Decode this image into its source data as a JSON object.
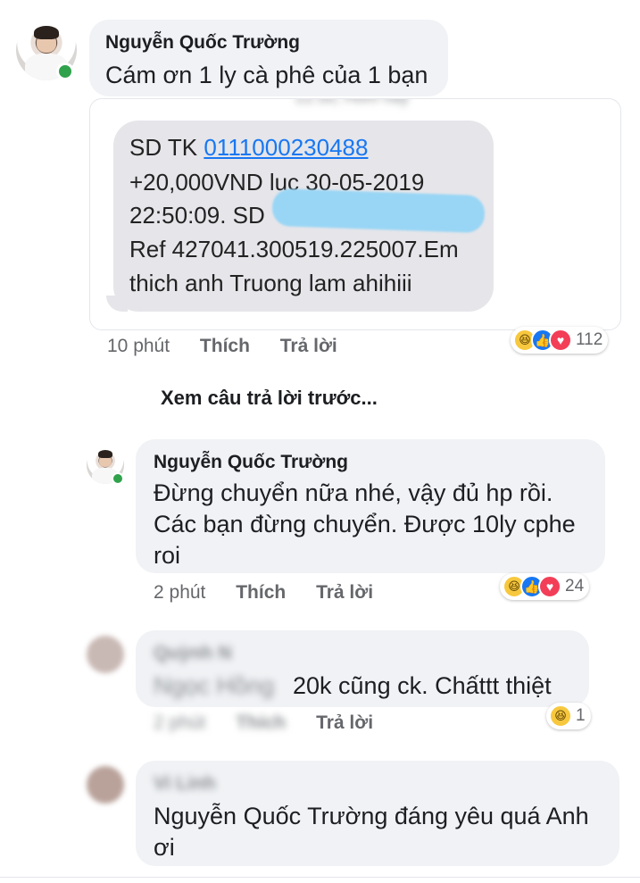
{
  "comments": [
    {
      "author": "Nguyễn Quốc Trường",
      "text": "Cám ơn 1 ly cà phê của 1 bạn",
      "attachment": {
        "header_partial": "22:50, Hôm nay",
        "lines": [
          {
            "prefix": "SD TK ",
            "link": "0111000230488"
          },
          {
            "text": "+20,000VND luc 30-05-2019"
          },
          {
            "text": "22:50:09. SD"
          },
          {
            "text": "Ref 427041.300519.225007.Em"
          },
          {
            "text": "thich anh Truong lam ahihiii"
          }
        ]
      },
      "time": "10 phút",
      "like_label": "Thích",
      "reply_label": "Trả lời",
      "reactions": [
        "haha",
        "like",
        "love"
      ],
      "reaction_count": "112"
    }
  ],
  "view_previous_replies": "Xem câu trả lời trước...",
  "replies": [
    {
      "author": "Nguyễn Quốc Trường",
      "lines": [
        "Đừng chuyển nữa nhé, vậy đủ hp rồi.",
        "Các bạn đừng chuyển. Được 10ly cphe",
        "roi"
      ],
      "time": "2 phút",
      "like_label": "Thích",
      "reply_label": "Trả lời",
      "reactions": [
        "haha",
        "like",
        "love"
      ],
      "reaction_count": "24"
    },
    {
      "author_blurred": "Quỳnh N",
      "tag_blurred": "Ngọc Hồng",
      "text": "20k cũng ck. Chấttt thiệt",
      "time": "2 phút",
      "like_label": "Thích",
      "reply_label": "Trả lời",
      "reactions": [
        "haha"
      ],
      "reaction_count": "1"
    },
    {
      "author_blurred": "Vi Linh",
      "lines": [
        "Nguyễn Quốc Trường đáng yêu quá Anh",
        "ơi"
      ]
    }
  ],
  "colors": {
    "bubble": "#f0f2f5",
    "link": "#1877f2",
    "online": "#31a24c",
    "sms_bubble": "#e5e5ea",
    "redaction": "#99d6f5"
  }
}
